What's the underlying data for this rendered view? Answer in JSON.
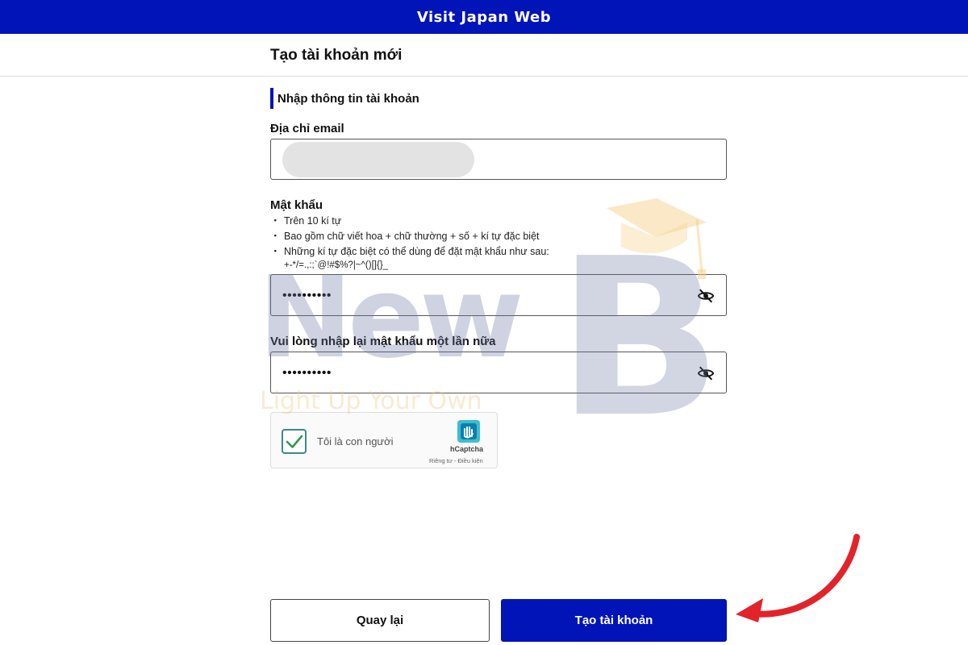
{
  "header": {
    "app_title": "Visit Japan Web"
  },
  "page": {
    "title": "Tạo tài khoản mới"
  },
  "section": {
    "title": "Nhập thông tin tài khoản"
  },
  "email": {
    "label": "Địa chỉ email",
    "value": ""
  },
  "password": {
    "label": "Mật khẩu",
    "rules": [
      "Trên 10 kí tự",
      "Bao gồm chữ viết hoa + chữ thường + số + kí tự đặc biệt",
      "Những kí tự đặc biệt có thể dùng để đặt mật khẩu như sau:"
    ],
    "special_chars": "+-*/=.,:;`@!#$%?|~^()[]{}_",
    "masked_value": "••••••••••",
    "toggle_icon": "eye-slash-icon"
  },
  "confirm_password": {
    "label": "Vui lòng nhập lại mật khẩu một lần nữa",
    "masked_value": "••••••••••",
    "toggle_icon": "eye-slash-icon"
  },
  "captcha": {
    "checkbox_label": "Tôi là con người",
    "checked": true,
    "brand": "hCaptcha",
    "links": "Riêng tư - Điều kiện"
  },
  "actions": {
    "back_label": "Quay lại",
    "create_label": "Tạo tài khoản"
  },
  "watermark": {
    "text": "New",
    "letter": "B",
    "tagline": "Light Up Your Own"
  },
  "colors": {
    "primary": "#0014b8",
    "arrow": "#e2232a",
    "checkbox": "#3c8a8a"
  }
}
